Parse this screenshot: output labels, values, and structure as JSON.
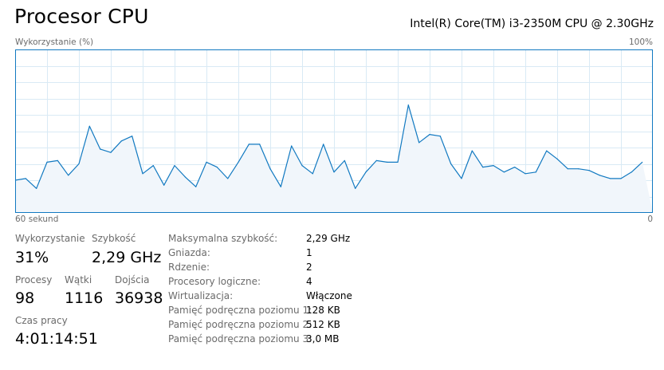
{
  "header": {
    "title": "Procesor CPU",
    "cpu_model": "Intel(R) Core(TM) i3-2350M CPU @ 2.30GHz"
  },
  "graph": {
    "label_left": "Wykorzystanie (%)",
    "label_right": "100%",
    "axis_left": "60 sekund",
    "axis_right": "0",
    "line_color": "#1179c1",
    "fill_color": "#f1f6fb",
    "grid_color": "#d9eaf5",
    "border_color": "#1179c1"
  },
  "chart_data": {
    "type": "area",
    "xlabel": "60 sekund",
    "ylabel": "Wykorzystanie (%)",
    "xlim": [
      60,
      0
    ],
    "ylim": [
      0,
      100
    ],
    "grid": true,
    "x": [
      60,
      59,
      58,
      57,
      56,
      55,
      54,
      53,
      52,
      51,
      50,
      49,
      48,
      47,
      46,
      45,
      44,
      43,
      42,
      41,
      40,
      39,
      38,
      37,
      36,
      35,
      34,
      33,
      32,
      31,
      30,
      29,
      28,
      27,
      26,
      25,
      24,
      23,
      22,
      21,
      20,
      19,
      18,
      17,
      16,
      15,
      14,
      13,
      12,
      11,
      10,
      9,
      8,
      7,
      6,
      5,
      4,
      3,
      2,
      1,
      0
    ],
    "series": [
      {
        "values": [
          20,
          21,
          15,
          31,
          32,
          23,
          30,
          53,
          39,
          37,
          44,
          47,
          24,
          29,
          17,
          29,
          22,
          16,
          31,
          28,
          21,
          31,
          42,
          42,
          27,
          16,
          41,
          29,
          24,
          42,
          25,
          32,
          15,
          25,
          32,
          31,
          31,
          66,
          43,
          48,
          47,
          30,
          21,
          38,
          28,
          29,
          25,
          28,
          24,
          25,
          38,
          33,
          27,
          27,
          26,
          23,
          21,
          21,
          25,
          31
        ]
      }
    ]
  },
  "stats": {
    "utilization": {
      "label": "Wykorzystanie",
      "value": "31%"
    },
    "speed": {
      "label": "Szybkość",
      "value": "2,29 GHz"
    },
    "processes": {
      "label": "Procesy",
      "value": "98"
    },
    "threads": {
      "label": "Wątki",
      "value": "1116"
    },
    "handles": {
      "label": "Dojścia",
      "value": "36938"
    },
    "uptime": {
      "label": "Czas pracy",
      "value": "4:01:14:51"
    }
  },
  "info": [
    {
      "key": "Maksymalna szybkość:",
      "value": "2,29 GHz"
    },
    {
      "key": "Gniazda:",
      "value": "1"
    },
    {
      "key": "Rdzenie:",
      "value": "2"
    },
    {
      "key": "Procesory logiczne:",
      "value": "4"
    },
    {
      "key": "Wirtualizacja:",
      "value": "Włączone"
    },
    {
      "key": "Pamięć podręczna poziomu 1:",
      "value": "128 KB"
    },
    {
      "key": "Pamięć podręczna poziomu 2:",
      "value": "512 KB"
    },
    {
      "key": "Pamięć podręczna poziomu 3:",
      "value": "3,0 MB"
    }
  ]
}
